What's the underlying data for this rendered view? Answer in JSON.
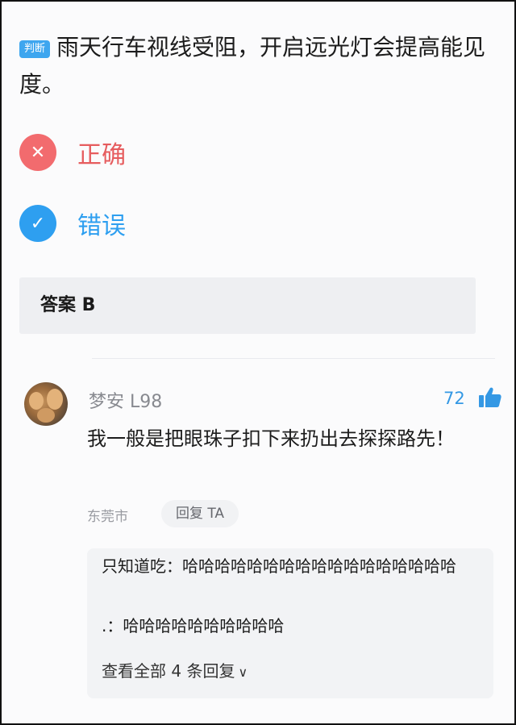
{
  "question": {
    "tag": "判断",
    "text": "雨天行车视线受阻，开启远光灯会提高能见度。"
  },
  "options": [
    {
      "label": "正确",
      "icon": "x-icon",
      "color": "#f26b6e"
    },
    {
      "label": "错误",
      "icon": "check-icon",
      "color": "#2e9ff0"
    }
  ],
  "answer": {
    "text": "答案 B"
  },
  "comment": {
    "username": "梦安 L98",
    "likes": "72",
    "text": "我一般是把眼珠子扣下来扔出去探探路先！",
    "location": "东莞市",
    "reply_button": "回复 TA",
    "replies": [
      {
        "author": "只知道吃：",
        "text": "哈哈哈哈哈哈哈哈哈哈哈哈哈哈哈哈哈"
      },
      {
        "author": ".：",
        "text": "哈哈哈哈哈哈哈哈哈哈"
      }
    ],
    "view_all": "查看全部 4 条回复"
  },
  "colors": {
    "accent": "#2e9ff0",
    "wrong": "#f26b6e",
    "like": "#3498e4"
  }
}
